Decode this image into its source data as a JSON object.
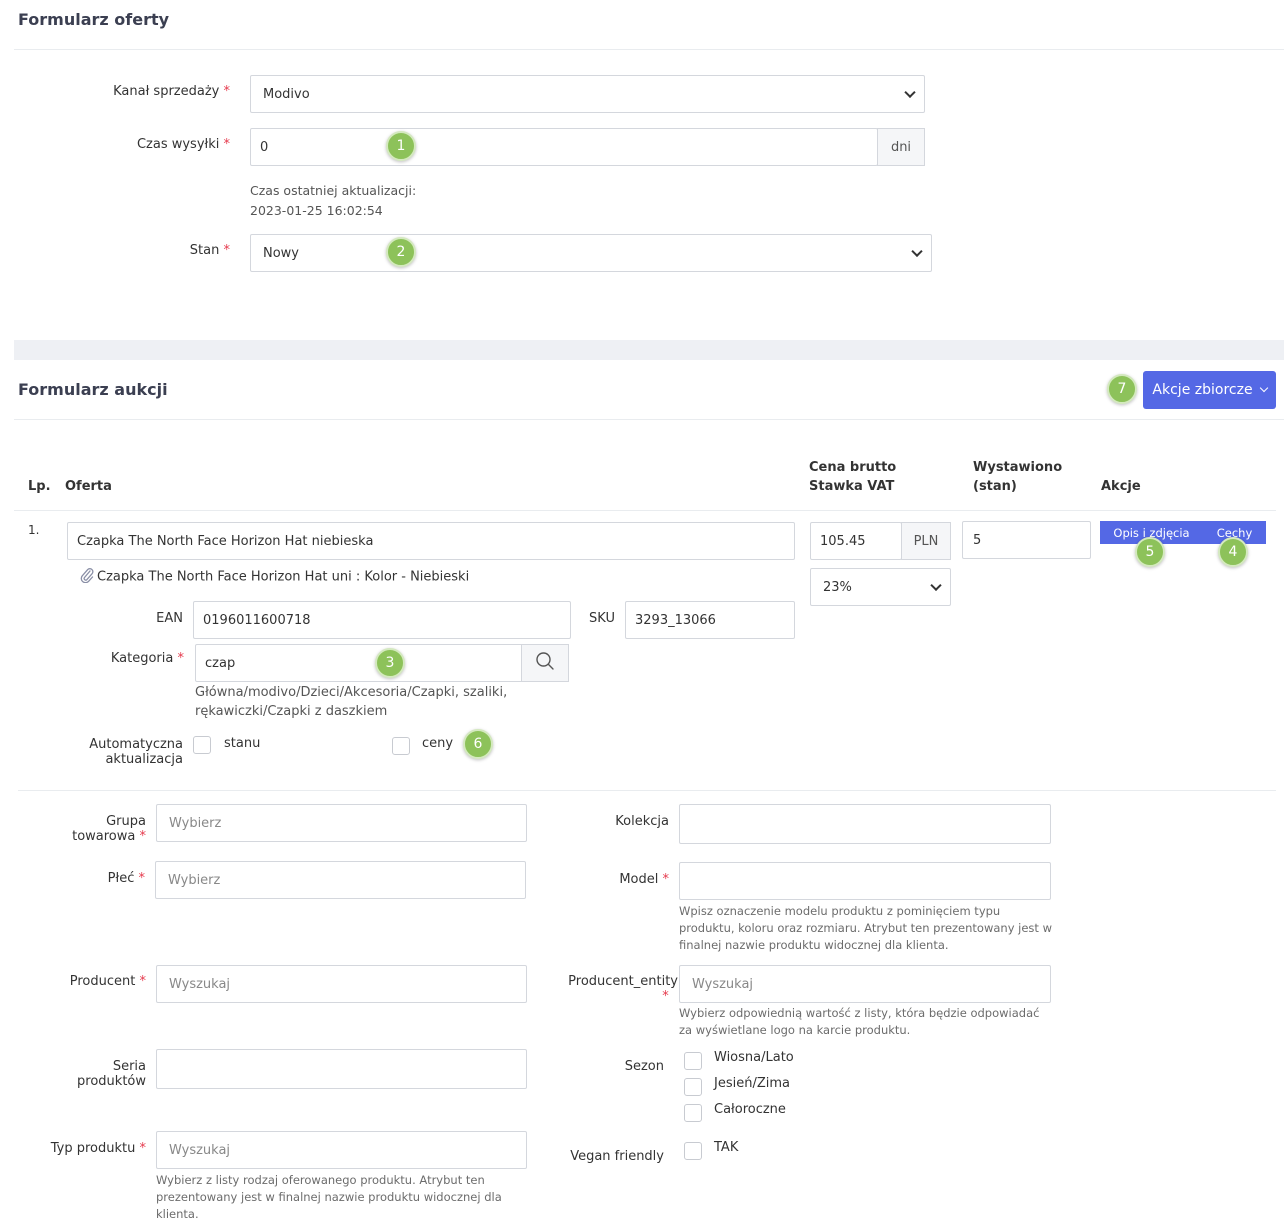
{
  "offer_form": {
    "title": "Formularz oferty",
    "sales_channel": {
      "label": "Kanał sprzedaży",
      "required": "*",
      "value": "Modivo"
    },
    "shipping_time": {
      "label": "Czas wysyłki",
      "required": "*",
      "value": "0",
      "suffix": "dni"
    },
    "last_update": {
      "label": "Czas ostatniej aktualizacji:",
      "value": "2023-01-25 16:02:54"
    },
    "condition": {
      "label": "Stan",
      "required": "*",
      "value": "Nowy"
    }
  },
  "auction_form": {
    "title": "Formularz aukcji",
    "bulk_actions_label": "Akcje zbiorcze",
    "table": {
      "headers": {
        "lp": "Lp.",
        "offer": "Oferta",
        "price_line1": "Cena brutto",
        "price_line2": "Stawka VAT",
        "listed_line1": "Wystawiono",
        "listed_line2": "(stan)",
        "actions": "Akcje"
      },
      "row": {
        "lp": "1.",
        "offer_title": "Czapka The North Face Horizon Hat niebieska",
        "variant": "Czapka The North Face Horizon Hat uni : Kolor - Niebieski",
        "price": "105.45",
        "currency": "PLN",
        "vat": "23%",
        "stock": "5",
        "desc_photos_label": "Opis i zdjęcia",
        "features_label": "Cechy",
        "ean_label": "EAN",
        "ean_value": "0196011600718",
        "sku_label": "SKU",
        "sku_value": "3293_13066",
        "category_label": "Kategoria",
        "category_required": "*",
        "category_value": "czap",
        "category_path_line1": "Główna/modivo/Dzieci/Akcesoria/Czapki, szaliki,",
        "category_path_line2": "rękawiczki/Czapki z daszkiem",
        "auto_update_line1": "Automatyczna",
        "auto_update_line2": "aktualizacja",
        "auto_stock_label": "stanu",
        "auto_price_label": "ceny"
      }
    },
    "attributes": {
      "product_group": {
        "label_line1": "Grupa",
        "label_line2": "towarowa",
        "required": "*",
        "placeholder": "Wybierz"
      },
      "gender": {
        "label": "Płeć",
        "required": "*",
        "placeholder": "Wybierz"
      },
      "producer": {
        "label": "Producent",
        "required": "*",
        "placeholder": "Wyszukaj"
      },
      "product_series": {
        "label_line1": "Seria",
        "label_line2": "produktów",
        "value": ""
      },
      "product_type": {
        "label": "Typ produktu",
        "required": "*",
        "placeholder": "Wyszukaj",
        "help_line1": "Wybierz z listy rodzaj oferowanego produktu. Atrybut ten",
        "help_line2": "prezentowany jest w finalnej nazwie produktu widocznej dla",
        "help_line3": "klienta."
      },
      "collection": {
        "label": "Kolekcja",
        "value": ""
      },
      "model": {
        "label": "Model",
        "required": "*",
        "value": "",
        "help_line1": "Wpisz oznaczenie modelu produktu z pominięciem typu",
        "help_line2": "produktu, koloru oraz rozmiaru. Atrybut ten prezentowany jest w",
        "help_line3": "finalnej nazwie produktu widocznej dla klienta."
      },
      "producer_entity": {
        "label": "Producent_entity",
        "required": "*",
        "placeholder": "Wyszukaj",
        "help_line1": "Wybierz odpowiednią wartość z listy, która będzie odpowiadać",
        "help_line2": "za wyświetlane logo na karcie produktu."
      },
      "season": {
        "label": "Sezon",
        "options": [
          "Wiosna/Lato",
          "Jesień/Zima",
          "Całoroczne"
        ]
      },
      "vegan": {
        "label": "Vegan friendly",
        "option": "TAK"
      }
    }
  },
  "markers": [
    "1",
    "2",
    "3",
    "4",
    "5",
    "6",
    "7"
  ],
  "colors": {
    "primary": "#5468e5",
    "marker": "#8dc25a",
    "required": "#e5384b"
  },
  "icons": {
    "search": "search-icon",
    "attachment": "paperclip-icon",
    "dropdown": "chevron-down-icon"
  }
}
